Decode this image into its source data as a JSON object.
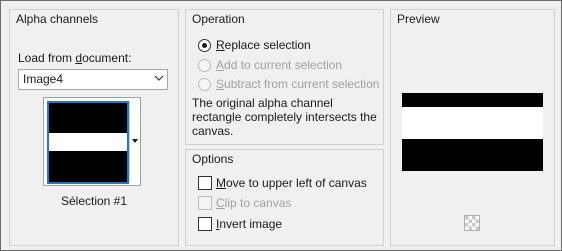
{
  "alpha_channels": {
    "title": "Alpha channels",
    "load_label_pre": "Load from ",
    "load_label_accel": "d",
    "load_label_post": "ocument:",
    "document_selected": "Image4",
    "selection_name": "Sélection #1"
  },
  "operation": {
    "title": "Operation",
    "options": [
      {
        "accel": "R",
        "rest": "eplace selection",
        "selected": true,
        "enabled": true
      },
      {
        "accel": "A",
        "rest": "dd to current selection",
        "selected": false,
        "enabled": false
      },
      {
        "accel": "S",
        "rest": "ubtract from current selection",
        "selected": false,
        "enabled": false
      }
    ],
    "description": "The original alpha channel rectangle completely intersects the canvas."
  },
  "options": {
    "title": "Options",
    "checks": [
      {
        "accel": "M",
        "rest": "ove to upper left of canvas",
        "checked": false,
        "enabled": true
      },
      {
        "accel": "C",
        "rest": "lip to canvas",
        "checked": false,
        "enabled": false
      },
      {
        "accel": "I",
        "rest": "nvert image",
        "checked": false,
        "enabled": true
      }
    ]
  },
  "preview": {
    "title": "Preview",
    "zoom_icon": "checkerboard-zoom-icon"
  },
  "colors": {
    "thumb_selected_border": "#1e78d7",
    "panel_bg": "#f0f0f0"
  }
}
